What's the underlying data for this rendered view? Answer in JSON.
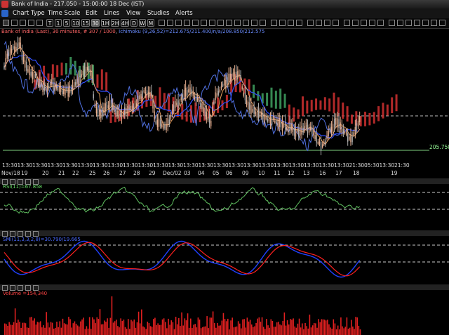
{
  "window": {
    "title": "Bank of India - 217.050 - 15:00:00  18 Dec (IST)"
  },
  "menu": {
    "items": [
      "Chart Type",
      "Time Scale",
      "Edit",
      "Lines",
      "View",
      "Studies",
      "Alerts"
    ]
  },
  "toolbar": {
    "left_buttons": [
      "T",
      "1",
      "5",
      "10",
      "15",
      "30",
      "1H",
      "2H",
      "4H",
      "D",
      "W",
      "M"
    ],
    "selected": "30"
  },
  "price_panel": {
    "info_line": {
      "symbol": "Bank of India (Last), 30 minutes, # 307 / 1000",
      "ichimoku": "Ichimoku (9,26,52)=212.675/211.400/n/a/208.850/212.575",
      "symbol_color": "#ff6666",
      "ichimoku_color": "#6a8cff"
    },
    "last_price_label": "205.750",
    "time_labels_top": [
      "13:30",
      "13:30",
      "13:30",
      "13:30",
      "13:30",
      "13:30",
      "13:30",
      "13:30",
      "13:30",
      "13:30",
      "13:30",
      "13:30",
      "13:30",
      "13:30",
      "13:30",
      "13:30",
      "13:30",
      "13:30",
      "13:30",
      "13:30",
      "13:30",
      "13:30",
      "13:30",
      "21:30",
      "05:30",
      "13:30",
      "21:30"
    ],
    "date_labels": [
      "Nov/18",
      "19",
      "20",
      "21",
      "22",
      "25",
      "26",
      "27",
      "28",
      "29",
      "Dec/02",
      "03",
      "04",
      "05",
      "06",
      "09",
      "10",
      "11",
      "12",
      "13",
      "16",
      "17",
      "18",
      "19"
    ]
  },
  "rsi_panel": {
    "label": "RSI(11)=67.858",
    "color": "#66dd66"
  },
  "smi_panel": {
    "label": "SMI(11,3,3,2,8)=30.790/19.665",
    "color": "#4a6aff"
  },
  "volume_panel": {
    "label": "Volume =154,340",
    "color": "#ff4444"
  },
  "colors": {
    "bull_candle": "#e8b090",
    "bear_candle": "#b0b0b0",
    "cloud_red": "#d03030",
    "cloud_green": "#40a060",
    "tenkan": "#e8a060",
    "kijun": "#3050ff",
    "chikou": "#5070e0",
    "rsi_line": "#60c060",
    "smi_blue": "#2040ff",
    "smi_red": "#ff2020",
    "volume_bar": "#e02020"
  }
}
